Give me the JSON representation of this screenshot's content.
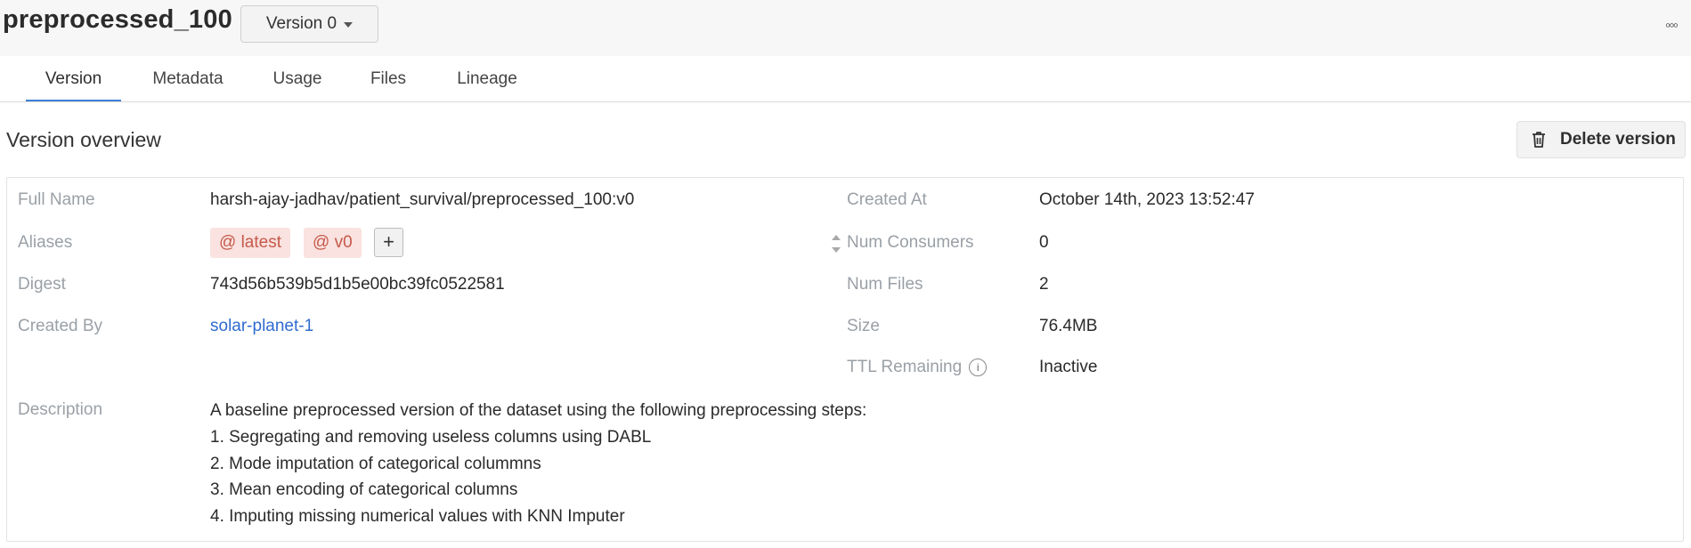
{
  "header": {
    "title": "preprocessed_100",
    "version_label": "Version 0",
    "more_label": "◦◦◦"
  },
  "tabs": [
    {
      "label": "Version"
    },
    {
      "label": "Metadata"
    },
    {
      "label": "Usage"
    },
    {
      "label": "Files"
    },
    {
      "label": "Lineage"
    }
  ],
  "overview": {
    "title": "Version overview",
    "delete_label": "Delete version"
  },
  "left": {
    "full_name_label": "Full Name",
    "full_name_value": "harsh-ajay-jadhav/patient_survival/preprocessed_100:v0",
    "aliases_label": "Aliases",
    "aliases": [
      "@ latest",
      "@ v0"
    ],
    "add_alias_label": "+",
    "digest_label": "Digest",
    "digest_value": "743d56b539b5d1b5e00bc39fc0522581",
    "created_by_label": "Created By",
    "created_by_value": "solar-planet-1",
    "description_label": "Description",
    "description_lines": [
      "A baseline preprocessed version of the dataset using the following preprocessing steps:",
      "1. Segregating and removing useless columns using DABL",
      "2. Mode imputation of categorical colummns",
      "3. Mean encoding of categorical columns",
      "4. Imputing missing numerical values with KNN Imputer"
    ]
  },
  "right": {
    "created_at_label": "Created At",
    "created_at_value": "October 14th, 2023 13:52:47",
    "num_consumers_label": "Num Consumers",
    "num_consumers_value": "0",
    "num_files_label": "Num Files",
    "num_files_value": "2",
    "size_label": "Size",
    "size_value": "76.4MB",
    "ttl_label": "TTL Remaining",
    "ttl_value": "Inactive"
  },
  "colors": {
    "accent": "#3f7fd7",
    "link": "#2f6bd0",
    "alias_bg": "#f9e2df",
    "alias_text": "#c6594b"
  }
}
